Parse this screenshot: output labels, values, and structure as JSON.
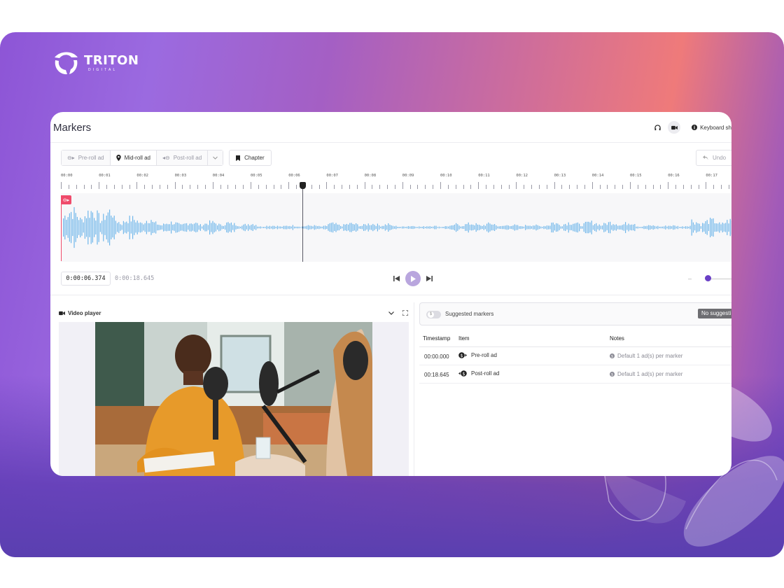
{
  "brand": {
    "name": "TRITON",
    "sub": "DIGITAL"
  },
  "page": {
    "title": "Markers"
  },
  "header": {
    "icons": [
      "headphones-icon",
      "video-camera-icon",
      "info-icon"
    ],
    "keyboard_label": "Keyboard sh"
  },
  "toolbar": {
    "pre_roll": "Pre-roll ad",
    "mid_roll": "Mid-roll ad",
    "post_roll": "Post-roll ad",
    "chapter": "Chapter",
    "undo": "Undo"
  },
  "timeline": {
    "labels": [
      "00:00",
      "00:01",
      "00:02",
      "00:03",
      "00:04",
      "00:05",
      "00:06",
      "00:07",
      "00:08",
      "00:09",
      "00:10",
      "00:11",
      "00:12",
      "00:13",
      "00:14",
      "00:15",
      "00:16",
      "00:17"
    ]
  },
  "transport": {
    "current_time": "0:00:06.374",
    "total_time": "0:00:18.645"
  },
  "video": {
    "title": "Video player"
  },
  "suggested": {
    "label": "Suggested markers",
    "badge": "No suggesti"
  },
  "table": {
    "headers": {
      "timestamp": "Timestamp",
      "item": "Item",
      "notes": "Notes"
    },
    "rows": [
      {
        "timestamp": "00:00.000",
        "item": "Pre-roll ad",
        "note": "Default 1 ad(s) per marker"
      },
      {
        "timestamp": "00:18.645",
        "item": "Post-roll ad",
        "note": "Default 1 ad(s) per marker"
      }
    ]
  },
  "colors": {
    "accent": "#6a3fc6",
    "marker": "#ef4b6b",
    "wave": "#6fb6ea"
  }
}
